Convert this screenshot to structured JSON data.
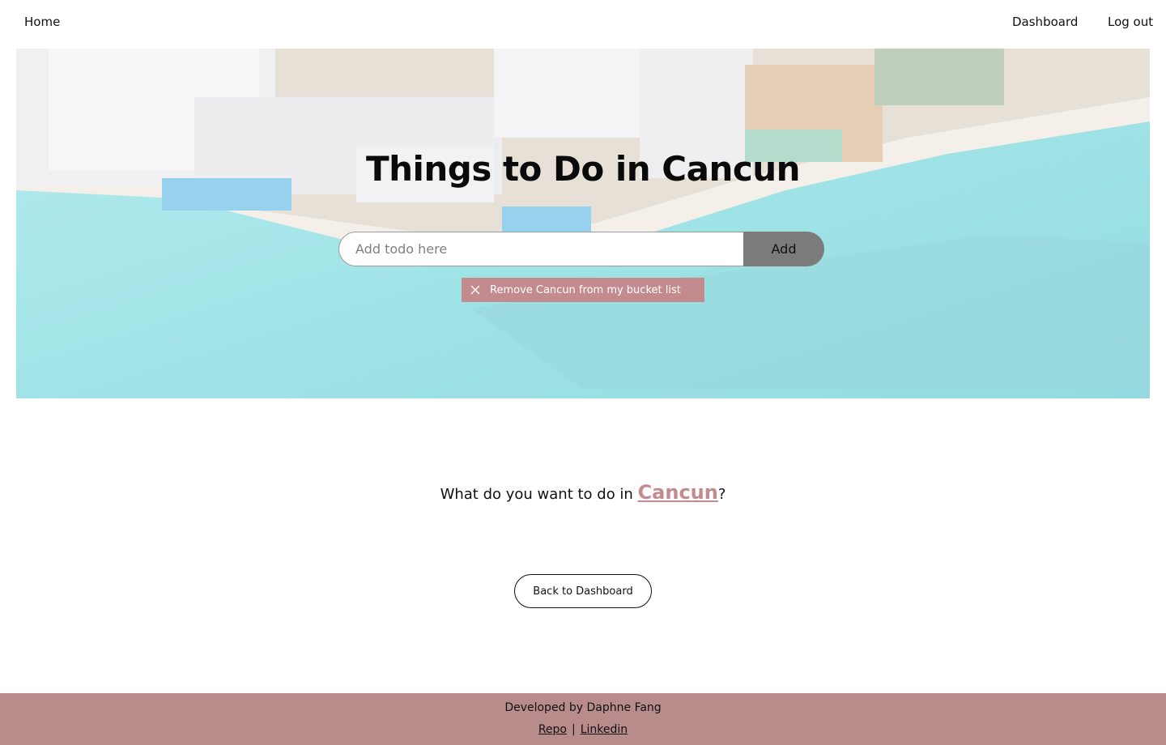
{
  "nav": {
    "home_label": "Home",
    "dashboard_label": "Dashboard",
    "logout_label": "Log out"
  },
  "hero": {
    "title": "Things to Do in Cancun",
    "input_placeholder": "Add todo here",
    "add_label": "Add",
    "remove_label": "Remove Cancun from my bucket list"
  },
  "prompt": {
    "prefix": "What do you want to do in ",
    "city": "Cancun",
    "suffix": "?"
  },
  "back_label": "Back to Dashboard",
  "footer": {
    "developer": "Developed by Daphne Fang",
    "repo_label": "Repo",
    "separator": "|",
    "linkedin_label": "Linkedin"
  },
  "colors": {
    "accent": "#c48b8f",
    "footer_bg": "#b98c8c",
    "add_button": "#7b7b7b"
  },
  "icons": {
    "remove": "close-icon"
  }
}
